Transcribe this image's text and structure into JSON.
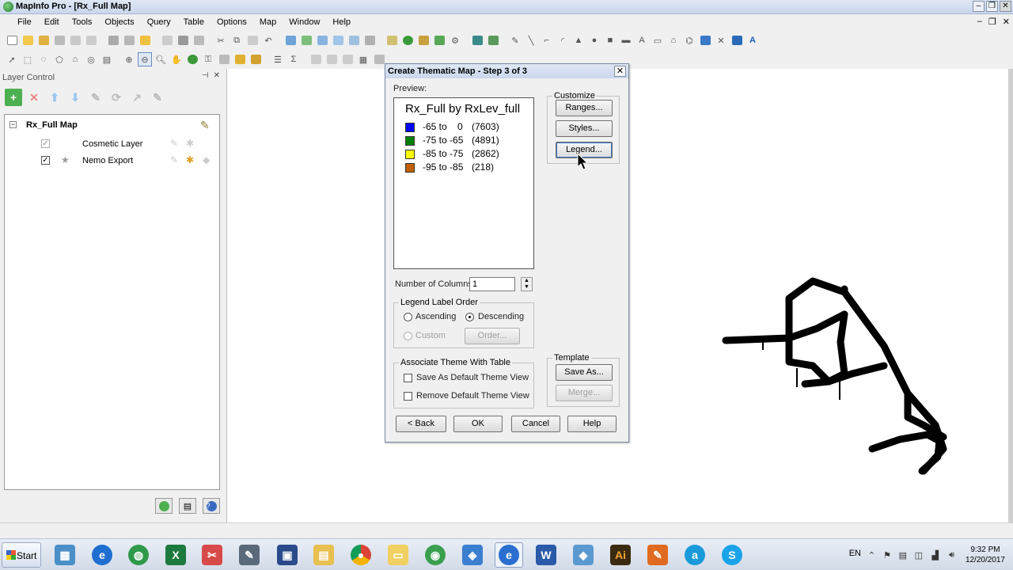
{
  "window": {
    "title": "MapInfo Pro - [Rx_Full Map]"
  },
  "menu": {
    "items": [
      "File",
      "Edit",
      "Tools",
      "Objects",
      "Query",
      "Table",
      "Options",
      "Map",
      "Window",
      "Help"
    ]
  },
  "layer_control": {
    "title": "Layer Control",
    "map_name": "Rx_Full Map",
    "layers": [
      {
        "name": "Cosmetic Layer",
        "checked": true
      },
      {
        "name": "Nemo Export",
        "checked": true
      }
    ]
  },
  "dialog": {
    "title": "Create Thematic Map - Step 3 of 3",
    "preview_label": "Preview:",
    "legend_title": "Rx_Full by RxLev_full",
    "legend": [
      {
        "range": "-65 to    0",
        "count": "(7603)",
        "color": "#0000ff"
      },
      {
        "range": "-75 to -65",
        "count": "(4891)",
        "color": "#008000"
      },
      {
        "range": "-85 to -75",
        "count": "(2862)",
        "color": "#ffff00"
      },
      {
        "range": "-95 to -85",
        "count": "(218)",
        "color": "#c06000"
      }
    ],
    "customize": {
      "title": "Customize",
      "ranges": "Ranges...",
      "styles": "Styles...",
      "legend": "Legend..."
    },
    "num_columns_label": "Number of Columns:",
    "num_columns_value": "1",
    "order": {
      "title": "Legend Label Order",
      "ascending": "Ascending",
      "descending": "Descending",
      "custom": "Custom",
      "order_btn": "Order..."
    },
    "associate": {
      "title": "Associate Theme With Table",
      "save_default": "Save As Default Theme View",
      "remove_default": "Remove Default Theme View"
    },
    "template": {
      "title": "Template",
      "save_as": "Save As...",
      "merge": "Merge..."
    },
    "buttons": {
      "back": "< Back",
      "ok": "OK",
      "cancel": "Cancel",
      "help": "Help"
    }
  },
  "taskbar": {
    "start": "Start",
    "language": "EN",
    "time": "9:32 PM",
    "date": "12/20/2017"
  }
}
